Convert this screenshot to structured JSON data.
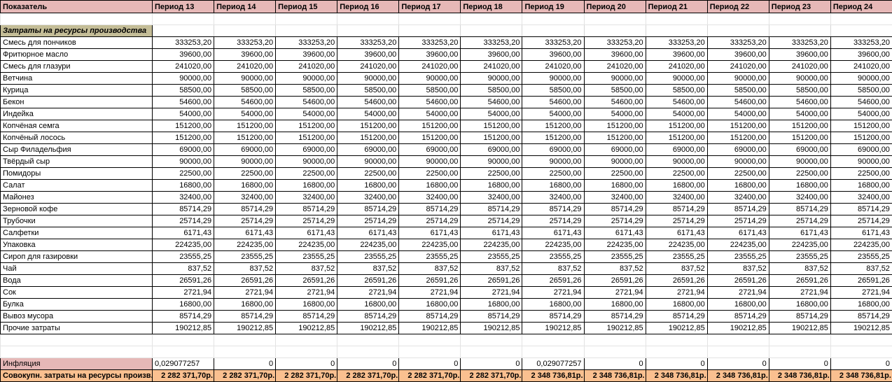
{
  "header": {
    "label": "Показатель",
    "periods": [
      "Период 13",
      "Период 14",
      "Период 15",
      "Период 16",
      "Период 17",
      "Период 18",
      "Период 19",
      "Период 20",
      "Период 21",
      "Период 22",
      "Период 23",
      "Период 24"
    ]
  },
  "section": {
    "title": "Затраты на ресурсы производства"
  },
  "rows": [
    {
      "name": "Смесь для пончиков",
      "value": "333253,20"
    },
    {
      "name": "Фритюрное масло",
      "value": "39600,00"
    },
    {
      "name": "Смесь для глазури",
      "value": "241020,00"
    },
    {
      "name": "Ветчина",
      "value": "90000,00"
    },
    {
      "name": "Курица",
      "value": "58500,00"
    },
    {
      "name": "Бекон",
      "value": "54600,00"
    },
    {
      "name": "Индейка",
      "value": "54000,00"
    },
    {
      "name": "Копчёная семга",
      "value": "151200,00"
    },
    {
      "name": "Копчёный лосось",
      "value": "151200,00"
    },
    {
      "name": "Сыр Филадельфия",
      "value": "69000,00"
    },
    {
      "name": "Твёрдый сыр",
      "value": "90000,00"
    },
    {
      "name": "Помидоры",
      "value": "22500,00"
    },
    {
      "name": "Салат",
      "value": "16800,00"
    },
    {
      "name": "Майонез",
      "value": "32400,00"
    },
    {
      "name": "Зерновой кофе",
      "value": "85714,29"
    },
    {
      "name": "Трубочки",
      "value": "25714,29"
    },
    {
      "name": "Салфетки",
      "value": "6171,43"
    },
    {
      "name": "Упаковка",
      "value": "224235,00"
    },
    {
      "name": "Сироп для газировки",
      "value": "23555,25"
    },
    {
      "name": "Чай",
      "value": "837,52"
    },
    {
      "name": "Вода",
      "value": "26591,26"
    },
    {
      "name": "Сок",
      "value": "2721,94"
    },
    {
      "name": "Булка",
      "value": "16800,00"
    },
    {
      "name": "Вывоз мусора",
      "value": "85714,29"
    },
    {
      "name": "Прочие затраты",
      "value": "190212,85"
    }
  ],
  "inflation": {
    "label": "Инфляция",
    "values": [
      "0,029077257",
      "0",
      "0",
      "0",
      "0",
      "0",
      "0,029077257",
      "0",
      "0",
      "0",
      "0",
      "0"
    ]
  },
  "total": {
    "label": "Совокупн. затраты на ресурсы произв.",
    "values": [
      "2 282 371,70р.",
      "2 282 371,70р.",
      "2 282 371,70р.",
      "2 282 371,70р.",
      "2 282 371,70р.",
      "2 282 371,70р.",
      "2 348 736,81р.",
      "2 348 736,81р.",
      "2 348 736,81р.",
      "2 348 736,81р.",
      "2 348 736,81р.",
      "2 348 736,81р."
    ]
  },
  "colors": {
    "header_bg": "#e6b8b7",
    "section_bg": "#c4bd97",
    "total_bg": "#fac090"
  }
}
